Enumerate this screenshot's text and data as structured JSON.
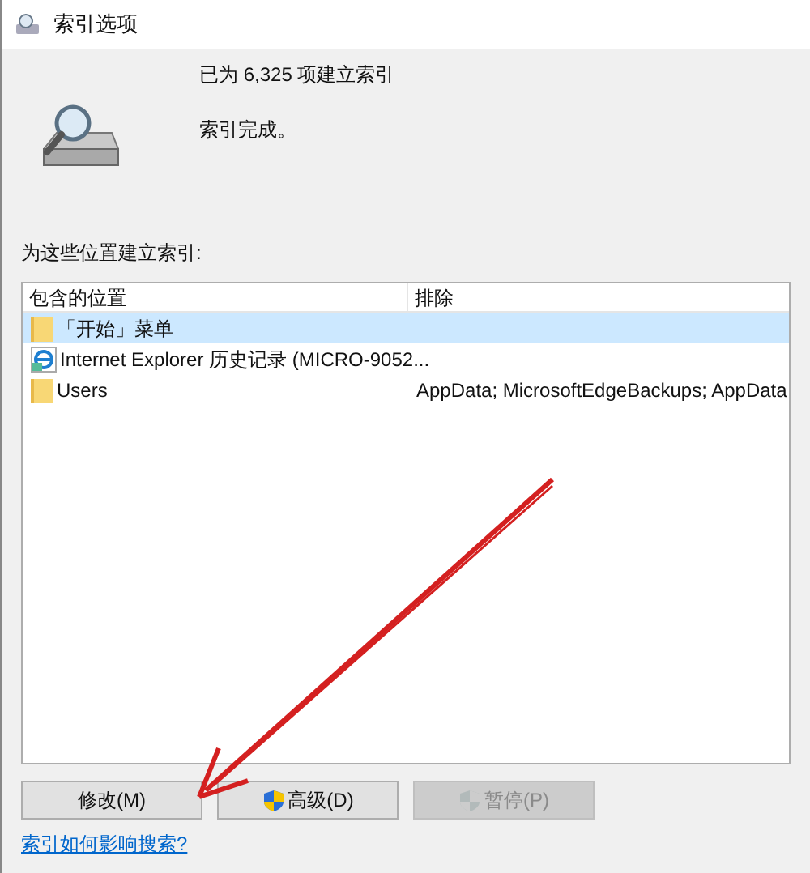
{
  "window": {
    "title": "索引选项"
  },
  "status": {
    "count_line": "已为 6,325 项建立索引",
    "state_line": "索引完成。"
  },
  "list_label": "为这些位置建立索引:",
  "table": {
    "columns": [
      "包含的位置",
      "排除"
    ],
    "rows": [
      {
        "kind": "folder",
        "location": "「开始」菜单",
        "exclude": "",
        "selected": true
      },
      {
        "kind": "ie",
        "location": "Internet Explorer 历史记录 (MICRO-9052...",
        "exclude": "",
        "selected": false
      },
      {
        "kind": "folder",
        "location": "Users",
        "exclude": "AppData; MicrosoftEdgeBackups; AppData",
        "selected": false
      }
    ]
  },
  "buttons": [
    {
      "label": "修改(M)",
      "shield": false,
      "disabled": false
    },
    {
      "label": "高级(D)",
      "shield": true,
      "disabled": false
    },
    {
      "label": "暂停(P)",
      "shield": true,
      "disabled": true
    }
  ],
  "link": "索引如何影响搜索?"
}
